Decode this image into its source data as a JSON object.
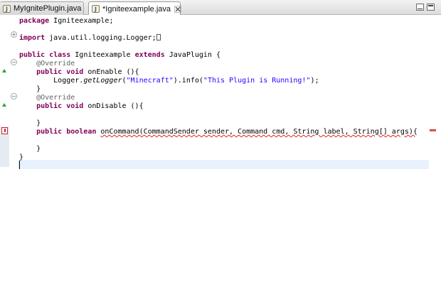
{
  "tabs": [
    {
      "label": "MyIgnitePlugin.java",
      "active": false
    },
    {
      "label": "*Igniteexample.java",
      "active": true
    }
  ],
  "editor": {
    "code_lines": [
      [
        {
          "t": "package ",
          "c": "kw"
        },
        {
          "t": "Igniteexample;",
          "c": ""
        }
      ],
      [],
      [
        {
          "t": "import ",
          "c": "kw"
        },
        {
          "t": "java.util.logging.Logger;",
          "c": ""
        },
        {
          "t": "",
          "c": "box"
        }
      ],
      [],
      [
        {
          "t": "public class ",
          "c": "kw"
        },
        {
          "t": "Igniteexample ",
          "c": ""
        },
        {
          "t": "extends ",
          "c": "kw"
        },
        {
          "t": "JavaPlugin {",
          "c": ""
        }
      ],
      [
        {
          "t": "    @Override",
          "c": "ann"
        }
      ],
      [
        {
          "t": "    public void ",
          "c": "kw"
        },
        {
          "t": "onEnable (){",
          "c": ""
        }
      ],
      [
        {
          "t": "        Logger.",
          "c": ""
        },
        {
          "t": "getLogger",
          "c": "it"
        },
        {
          "t": "(",
          "c": ""
        },
        {
          "t": "\"Minecraft\"",
          "c": "str"
        },
        {
          "t": ").info(",
          "c": ""
        },
        {
          "t": "\"This Plugin is Running!\"",
          "c": "str"
        },
        {
          "t": ");",
          "c": ""
        }
      ],
      [
        {
          "t": "    }",
          "c": ""
        }
      ],
      [
        {
          "t": "    @Override",
          "c": "ann"
        }
      ],
      [
        {
          "t": "    public void ",
          "c": "kw"
        },
        {
          "t": "onDisable (){",
          "c": ""
        }
      ],
      [],
      [
        {
          "t": "    }",
          "c": ""
        }
      ],
      [
        {
          "t": "    public boolean ",
          "c": "kw"
        },
        {
          "t": "onCommand(CommandSender sender, Command cmd, String label, String[] args){",
          "c": "err"
        }
      ],
      [],
      [
        {
          "t": "    }",
          "c": ""
        }
      ],
      [
        {
          "t": "}",
          "c": ""
        }
      ],
      []
    ]
  }
}
